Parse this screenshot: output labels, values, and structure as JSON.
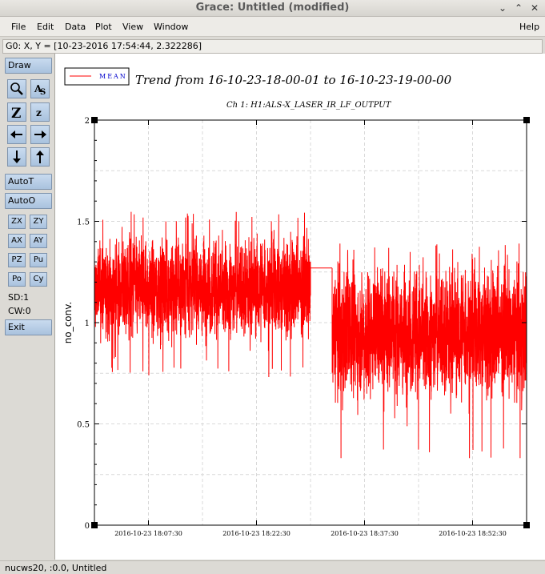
{
  "window": {
    "title": "Grace: Untitled (modified)"
  },
  "menu": [
    "File",
    "Edit",
    "Data",
    "Plot",
    "View",
    "Window",
    "Help"
  ],
  "coords": "G0: X, Y = [10-23-2016 17:54:44, 2.322286]",
  "toolbar": {
    "draw": "Draw",
    "autot": "AutoT",
    "autoo": "AutoO",
    "small": [
      "ZX",
      "ZY",
      "AX",
      "AY",
      "PZ",
      "Pu",
      "Po",
      "Cy"
    ],
    "sd": "SD:1",
    "cw": "CW:0",
    "exit": "Exit"
  },
  "statusbar": "nucws20, :0.0, Untitled",
  "chart_data": {
    "type": "line",
    "title": "Trend from 16-10-23-18-00-01 to 16-10-23-19-00-00",
    "subtitle": "Ch 1: H1:ALS-X_LASER_IR_LF_OUTPUT",
    "ylabel": "no_conv.",
    "xlabel": "",
    "legend": {
      "label": "MEAN",
      "placement": "top-left"
    },
    "ylim": [
      0,
      2
    ],
    "yticks": [
      "0",
      "0.5",
      "1",
      "1.5",
      "2"
    ],
    "xticks": [
      "2016-10-23 18:07:30",
      "2016-10-23 18:22:30",
      "2016-10-23 18:37:30",
      "2016-10-23 18:52:30"
    ],
    "grid": true,
    "color": "#ff0000",
    "series": [
      {
        "name": "MEAN",
        "x_start": "2016-10-23 18:00:01",
        "x_end": "2016-10-23 19:00:00",
        "segments": [
          {
            "from_min": 0.0,
            "to_min": 30.0,
            "mean": 1.17,
            "range": [
              0.73,
              1.55
            ]
          },
          {
            "from_min": 30.0,
            "to_min": 33.0,
            "mean": 1.27,
            "range": [
              1.27,
              1.27
            ]
          },
          {
            "from_min": 33.0,
            "to_min": 60.0,
            "mean": 0.95,
            "range": [
              0.33,
              1.39
            ]
          }
        ]
      }
    ]
  }
}
